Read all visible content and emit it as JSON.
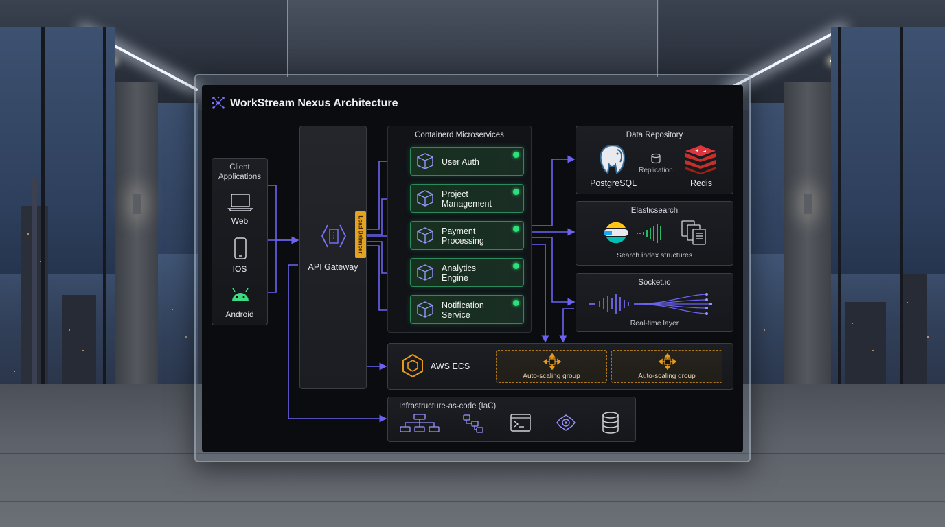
{
  "diagram": {
    "title": "WorkStream Nexus Architecture",
    "client": {
      "title": "Client Applications",
      "items": [
        "Web",
        "IOS",
        "Android"
      ]
    },
    "gateway": {
      "label": "API Gateway",
      "load_balancer_tag": "Load Balancer"
    },
    "microservices": {
      "title": "Containerd Microservices",
      "services": [
        {
          "label": "User Auth",
          "status_color": "#2ee07a"
        },
        {
          "label": "Project Management",
          "status_color": "#2ee07a"
        },
        {
          "label": "Payment Processing",
          "status_color": "#2ee07a"
        },
        {
          "label": "Analytics Engine",
          "status_color": "#2ee07a"
        },
        {
          "label": "Notification Service",
          "status_color": "#2ee07a"
        }
      ]
    },
    "data_repository": {
      "title": "Data Repository",
      "postgres": "PostgreSQL",
      "replication": "Replication",
      "redis": "Redis"
    },
    "elasticsearch": {
      "title": "Elasticsearch",
      "caption": "Search index structures"
    },
    "socketio": {
      "title": "Socket.io",
      "caption": "Real-time layer"
    },
    "ecs": {
      "label": "AWS ECS",
      "groups": [
        "Auto-scaling group",
        "Auto-scaling group"
      ]
    },
    "iac": {
      "title": "Infrastructure-as-code (IaC)"
    },
    "colors": {
      "accent": "#6b63f0",
      "healthy": "#2ee07a",
      "ecs_orange": "#e89a1c",
      "redis_red": "#d9363e"
    },
    "icons": [
      "network-logo-icon",
      "laptop-icon",
      "phone-icon",
      "android-icon",
      "gateway-icon",
      "cube-icon",
      "postgres-elephant-icon",
      "database-icon",
      "redis-stack-icon",
      "elasticsearch-icon",
      "documents-icon",
      "waveform-icon",
      "ecs-hexagon-icon",
      "scaling-arrows-icon",
      "flowchart-icon",
      "terminal-icon",
      "cloud-gear-icon"
    ]
  }
}
